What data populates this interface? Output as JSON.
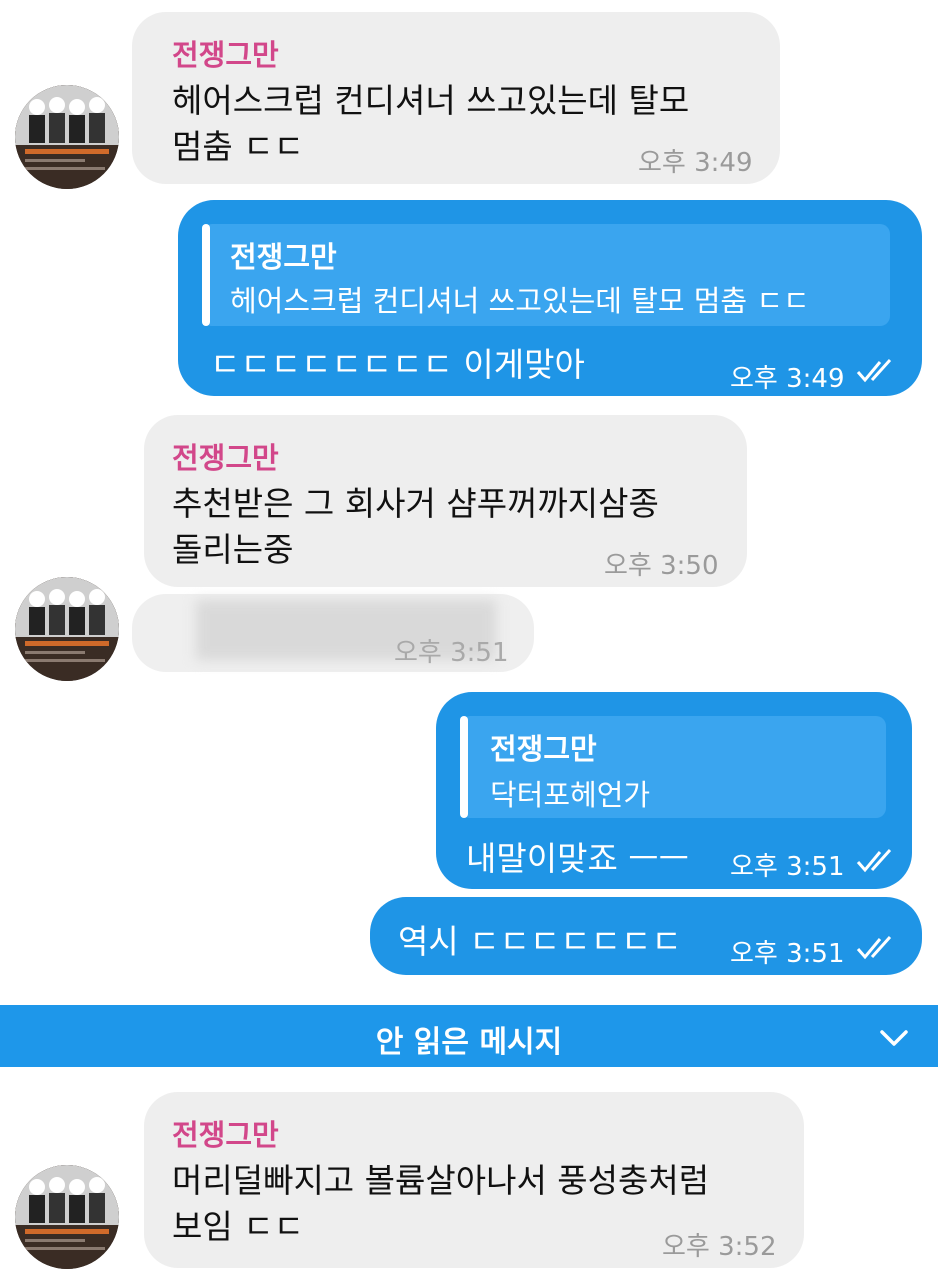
{
  "messages": [
    {
      "sender": "전쟁그만",
      "lines": [
        "헤어스크럽 컨디셔너 쓰고있는데 탈모",
        "멈춤 ㄷㄷ"
      ],
      "time": "오후 3:49"
    },
    {
      "quote_sender": "전쟁그만",
      "quote_text": "헤어스크럽 컨디셔너 쓰고있는데 탈모 멈춤 ㄷㄷ",
      "text": "ㄷㄷㄷㄷㄷㄷㄷㄷ 이게맞아",
      "time": "오후 3:49"
    },
    {
      "sender": "전쟁그만",
      "lines": [
        "추천받은 그 회사거 샴푸꺼까지삼종",
        "돌리는중"
      ],
      "time": "오후 3:50"
    },
    {
      "time": "오후 3:51"
    },
    {
      "quote_sender": "전쟁그만",
      "quote_text": "닥터포헤언가",
      "text": "내말이맞죠 ㅡㅡ",
      "time": "오후 3:51"
    },
    {
      "text": "역시 ㄷㄷㄷㄷㄷㄷㄷ",
      "time": "오후 3:51"
    },
    {
      "sender": "전쟁그만",
      "lines": [
        "머리덜빠지고 볼륨살아나서 풍성충처럼",
        "보임 ㄷㄷ"
      ],
      "time": "오후 3:52"
    }
  ],
  "unread_banner": {
    "label": "안 읽은 메시지",
    "icon": "chevron-down-icon"
  },
  "colors": {
    "outgoing_bubble": "#1f95e6",
    "incoming_bubble": "#eeeeee",
    "sender_name": "#d2478a",
    "banner": "#1e97ea"
  }
}
